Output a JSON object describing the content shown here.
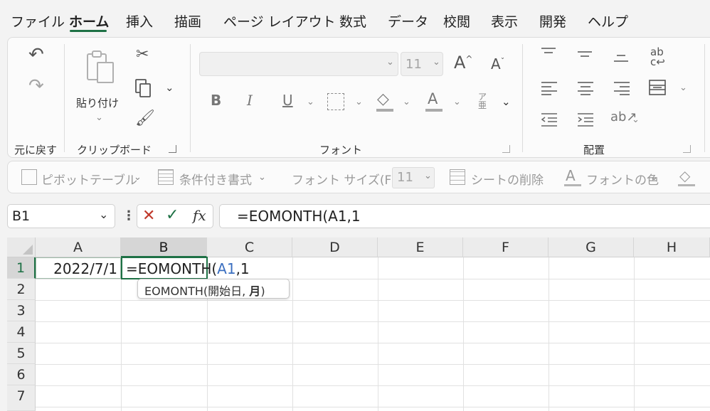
{
  "menu": {
    "tabs": [
      "ファイル",
      "ホーム",
      "挿入",
      "描画",
      "ページ レイアウト",
      "数式",
      "データ",
      "校閲",
      "表示",
      "開発",
      "ヘルプ"
    ],
    "active": "ホーム"
  },
  "ribbon": {
    "undo_group_label": "元に戻す",
    "clipboard": {
      "paste_label": "貼り付け",
      "group_label": "クリップボード"
    },
    "font": {
      "family_value": "",
      "size_value": "11",
      "group_label": "フォント"
    },
    "alignment": {
      "group_label": "配置"
    }
  },
  "quickbar": {
    "pivot_table": "ピボットテーブル",
    "conditional_format": "条件付き書式",
    "font_size_label": "フォント サイズ(F):",
    "font_size_value": "11",
    "delete_sheet": "シートの削除",
    "font_color": "フォントの色"
  },
  "formula_bar": {
    "name_box": "B1",
    "fx": "fx",
    "formula": "=EOMONTH(A1,1"
  },
  "grid": {
    "columns": [
      "A",
      "B",
      "C",
      "D",
      "E",
      "F",
      "G",
      "H"
    ],
    "rows": [
      "1",
      "2",
      "3",
      "4",
      "5",
      "6",
      "7"
    ],
    "selected_column": "B",
    "selected_row": "1",
    "cells": {
      "A1": "2022/7/1",
      "B1_prefix": "=EOMONTH(",
      "B1_ref": "A1",
      "B1_suffix": ",1"
    },
    "tooltip": {
      "func": "EOMONTH(開始日, ",
      "arg_bold": "月",
      "close": ")"
    }
  },
  "colors": {
    "accent": "#1e7145",
    "reference": "#3b6fc0",
    "ribbon_bg": "#fbfbfb",
    "app_bg": "#f3f3f3"
  }
}
